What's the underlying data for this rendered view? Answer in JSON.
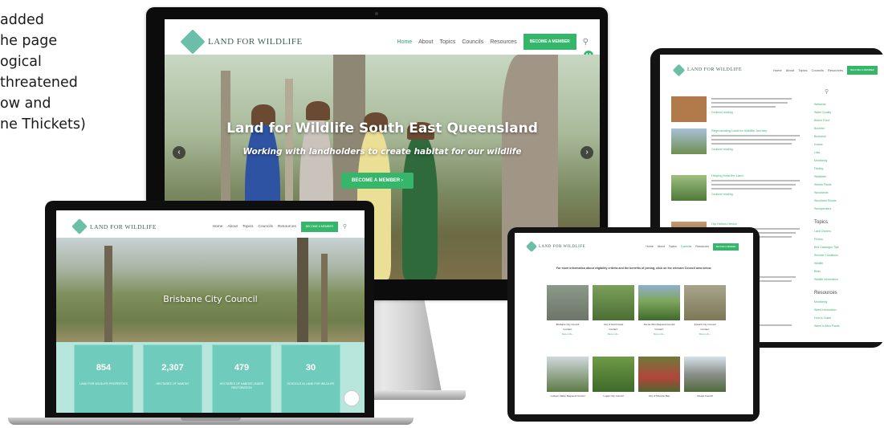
{
  "side_text": {
    "lines": [
      "added",
      "he page",
      "ogical",
      "threatened",
      "ow and",
      "ne Thickets)"
    ]
  },
  "brand": {
    "logo_text": "LAND FOR WILDLIFE",
    "colors": {
      "accent": "#35b66a",
      "teal": "#6fcbbc",
      "logo": "#6bbfa8"
    }
  },
  "desktop": {
    "nav": [
      "Home",
      "About",
      "Topics",
      "Councils",
      "Resources"
    ],
    "active_nav": "Home",
    "cta": "BECOME A MEMBER",
    "search_icon": "search-icon",
    "avatar_badge": "AA",
    "hero_title": "Land for Wildlife South East Queensland",
    "hero_subtitle": "Working with landholders to create habitat for our wildlife",
    "hero_button": "BECOME A MEMBER ›",
    "prev_icon": "chevron-left-icon",
    "next_icon": "chevron-right-icon"
  },
  "laptop": {
    "nav": [
      "Home",
      "About",
      "Topics",
      "Councils",
      "Resources"
    ],
    "cta": "BECOME A MEMBER",
    "hero_title": "Brisbane City Council",
    "stats": [
      {
        "value": "854",
        "label": "LAND FOR WILDLIFE PROPERTIES"
      },
      {
        "value": "2,307",
        "label": "HECTARES OF HABITAT"
      },
      {
        "value": "479",
        "label": "HECTARES OF HABITAT UNDER RESTORATION"
      },
      {
        "value": "30",
        "label": "SCHOOLS IN LAND FOR WILDLIFE"
      }
    ]
  },
  "tablet_right": {
    "nav": [
      "Home",
      "About",
      "Topics",
      "Councils",
      "Resources"
    ],
    "cta": "BECOME A MEMBER",
    "posts": [
      {
        "title": "",
        "read_more": "Continue reading"
      },
      {
        "title": "Regenerating Land for Wildlife Journey",
        "read_more": "Continue reading"
      },
      {
        "title": "Helping Heal the Land",
        "read_more": "Continue reading"
      },
      {
        "title": "Hip Hollow Hector",
        "read_more": "Continue reading"
      },
      {
        "title": "...ing",
        "read_more": ""
      },
      {
        "title": "...ontinuous Planting",
        "read_more": ""
      }
    ],
    "sidebar_categories": [
      "Wetlands",
      "Water Quality",
      "Beach Front",
      "Bushfire",
      "Bushland",
      "Koalas",
      "Lists",
      "Monitoring",
      "Fishing",
      "Wallabies",
      "Weeds Plants",
      "Woodlands",
      "Woodland Shrubs",
      "Woodpeckers"
    ],
    "topics_heading": "Topics",
    "topics": [
      "Land Owners",
      "Photos",
      "Bird Catalogue Tips",
      "Remote Conditions",
      "Wildlife",
      "Birds",
      "Wildlife Information"
    ],
    "resources_heading": "Resources",
    "resources": [
      "Monitoring",
      "Weed Information",
      "How to Guide",
      "Weed & Alien Plants"
    ]
  },
  "tablet_mid": {
    "nav": [
      "Home",
      "About",
      "Topics",
      "Councils",
      "Resources"
    ],
    "cta": "BECOME A MEMBER",
    "intro": "For more information about eligibility criteria and the benefits of joining, click on the relevant Council area below.",
    "councils": [
      {
        "name": "Brisbane City Council",
        "contact": "Contact:",
        "more": "More info ›"
      },
      {
        "name": "City of Gold Coast",
        "contact": "Contact:",
        "more": "More info ›"
      },
      {
        "name": "Scenic Rim Regional Council",
        "contact": "Contact:",
        "more": "More info ›"
      },
      {
        "name": "Ipswich City Council",
        "contact": "Contact:",
        "more": "More info ›"
      },
      {
        "name": "Lockyer Valley Regional Council",
        "contact": "",
        "more": ""
      },
      {
        "name": "Logan City Council",
        "contact": "",
        "more": ""
      },
      {
        "name": "City of Moreton Bay",
        "contact": "",
        "more": ""
      },
      {
        "name": "Noosa Council",
        "contact": "",
        "more": ""
      }
    ]
  }
}
